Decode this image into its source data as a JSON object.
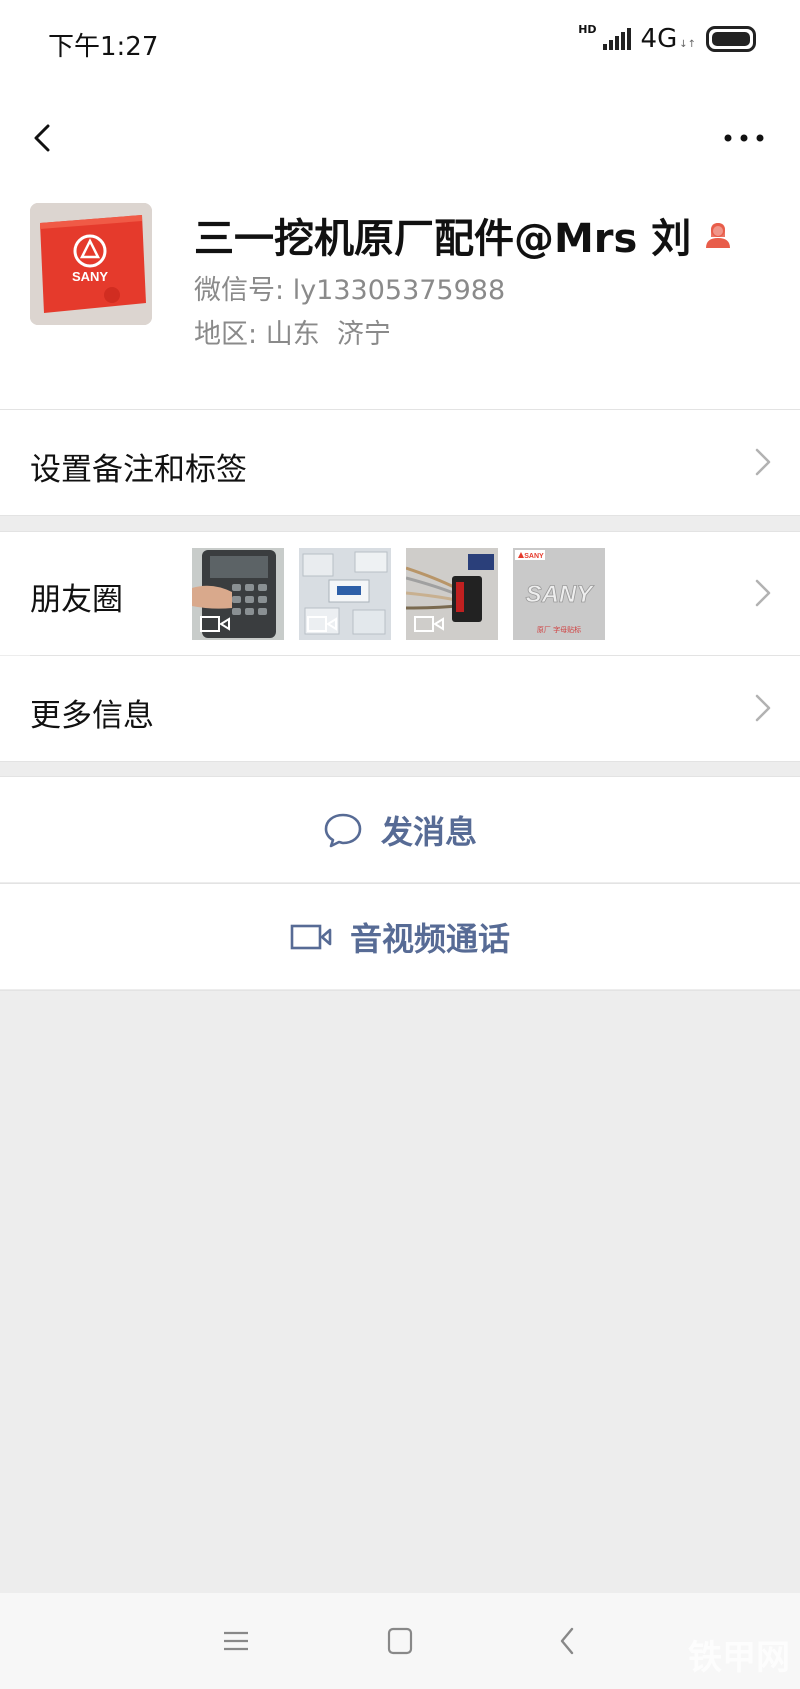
{
  "status_bar": {
    "time": "下午1:27",
    "hd": "HD",
    "network": "4G",
    "network_sub": "↓↑"
  },
  "nav": {
    "back_icon": "chevron-left-icon",
    "more_icon": "more-dots-icon"
  },
  "profile": {
    "name": "三一挖机原厂配件@Mrs 刘",
    "gender_icon": "female-icon",
    "wechat_id_label": "微信号:",
    "wechat_id": "ly13305375988",
    "region_label": "地区:",
    "region": "山东  济宁",
    "avatar_text": "SANY",
    "accent_color": "#e85d4a"
  },
  "menu": {
    "remark_label": "设置备注和标签",
    "moments_label": "朋友圈",
    "more_info_label": "更多信息"
  },
  "moments": [
    {
      "type": "video",
      "desc": "keypad"
    },
    {
      "type": "video",
      "desc": "KPM parts"
    },
    {
      "type": "video",
      "desc": "wiring connector"
    },
    {
      "type": "image",
      "desc": "SANY emblem",
      "badge": "SANY",
      "caption": "原厂 字母贴标",
      "big_text": "SANY"
    }
  ],
  "actions": {
    "message_label": "发消息",
    "message_icon": "chat-bubble-icon",
    "call_label": "音视频通话",
    "call_icon": "video-camera-icon",
    "link_color": "#576b95"
  },
  "system_nav": {
    "menu_icon": "menu-icon",
    "home_icon": "home-square-icon",
    "back_icon": "back-triangle-icon"
  },
  "watermark": "铁甲网"
}
